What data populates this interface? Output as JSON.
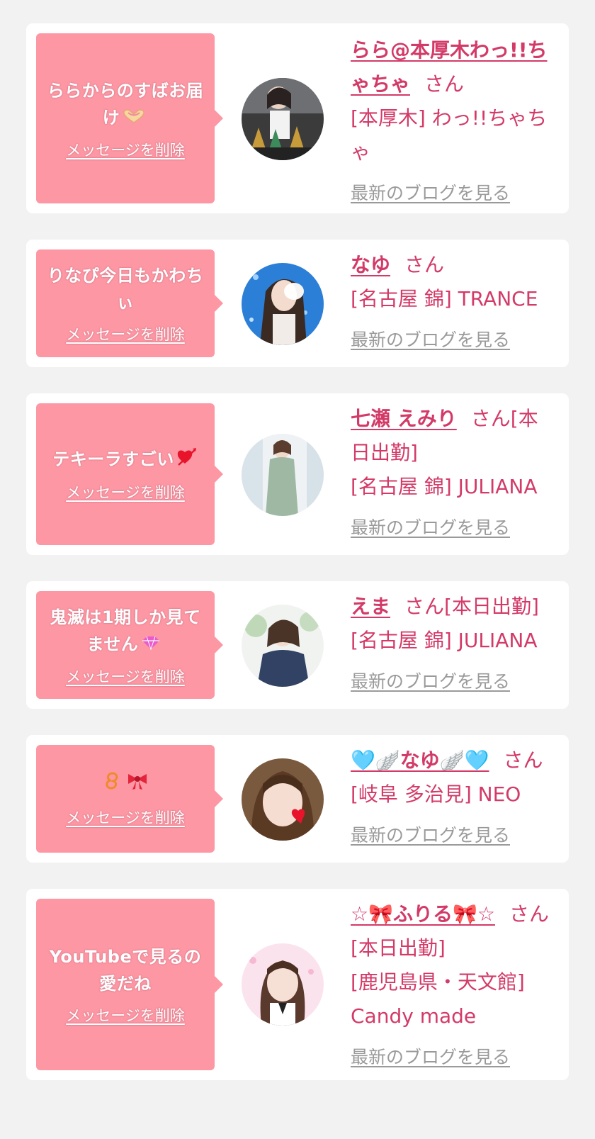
{
  "delete_label": "メッセージを削除",
  "blog_label": "最新のブログを見る",
  "san_label": "さん",
  "colors": {
    "background": "#f2f2f2",
    "card": "#ffffff",
    "bubble": "#fd97a4",
    "name": "#d33a68",
    "link_gray": "#9a9a9a"
  },
  "messages": [
    {
      "message": "ららからのすばお届け",
      "message_emoji": "heart-hands-icon",
      "name": "らら@本厚木わっ!!ちゃちゃ",
      "suffix": "",
      "shop": "[本厚木] わっ!!ちゃちゃ"
    },
    {
      "message": "りなぴ今日もかわちぃ",
      "message_emoji": "",
      "name": "なゆ",
      "suffix": "",
      "shop": "[名古屋 錦] TRANCE"
    },
    {
      "message": "テキーラすごい",
      "message_emoji": "heart-arrow-icon",
      "name": "七瀬 えみり",
      "suffix": "[本日出勤]",
      "shop": "[名古屋 錦] JULIANA"
    },
    {
      "message": "鬼滅は1期しか見てません",
      "message_emoji": "pink-gem-icon",
      "name": "えま",
      "suffix": "[本日出勤]",
      "shop": "[名古屋 錦] JULIANA"
    },
    {
      "message": "",
      "message_emoji": "curl-and-ribbon-icons",
      "name": "🩵🪽なゆ🪽🩵",
      "suffix": "",
      "shop": "[岐阜 多治見] NEO"
    },
    {
      "message": "YouTubeで見るの愛だね",
      "message_emoji": "",
      "name": "☆🎀ふりる🎀☆",
      "suffix": "[本日出勤]",
      "shop": "[鹿児島県・天文館] Candy made"
    }
  ]
}
